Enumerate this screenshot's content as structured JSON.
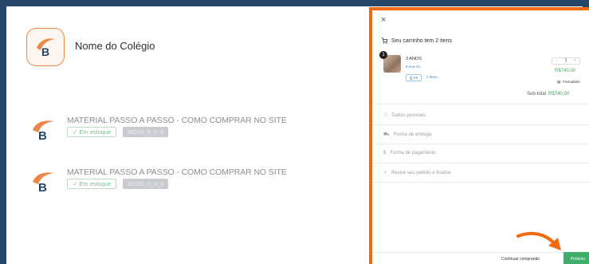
{
  "school": {
    "name": "Nome do Colégio",
    "logo_letter": "B"
  },
  "products": [
    {
      "title": "MATERIAL PASSO A PASSO - COMO COMPRAR NO SITE",
      "stock": "✓ Em estoque",
      "sku": "MG00_0_0_0"
    },
    {
      "title": "MATERIAL PASSO A PASSO - COMO COMPRAR NO SITE",
      "stock": "✓ Em estoque",
      "sku": "MG00_0_0_0"
    }
  ],
  "cart": {
    "close": "×",
    "header": "Seu carrinho tem 2 itens",
    "item": {
      "count": "1",
      "name": "3 ANOS",
      "sub": "Ana Vic",
      "tag": "KIt",
      "tag2": "2 itens",
      "stepper_minus": "−",
      "stepper_value": "1",
      "stepper_plus": "+",
      "price": "R$740,00",
      "form_label": "Formulário"
    },
    "subtotal_label": "Sub-total",
    "subtotal_value": "R$740,00",
    "steps": [
      "Dados pessoais",
      "Forma de entrega",
      "Forma de pagamento",
      "Revise seu pedido e finalize"
    ],
    "continue_label": "Continuar comprando",
    "next_label": "Próximo"
  },
  "colors": {
    "accent": "#f26a10",
    "success": "#3fae6a",
    "background": "#24466b"
  }
}
